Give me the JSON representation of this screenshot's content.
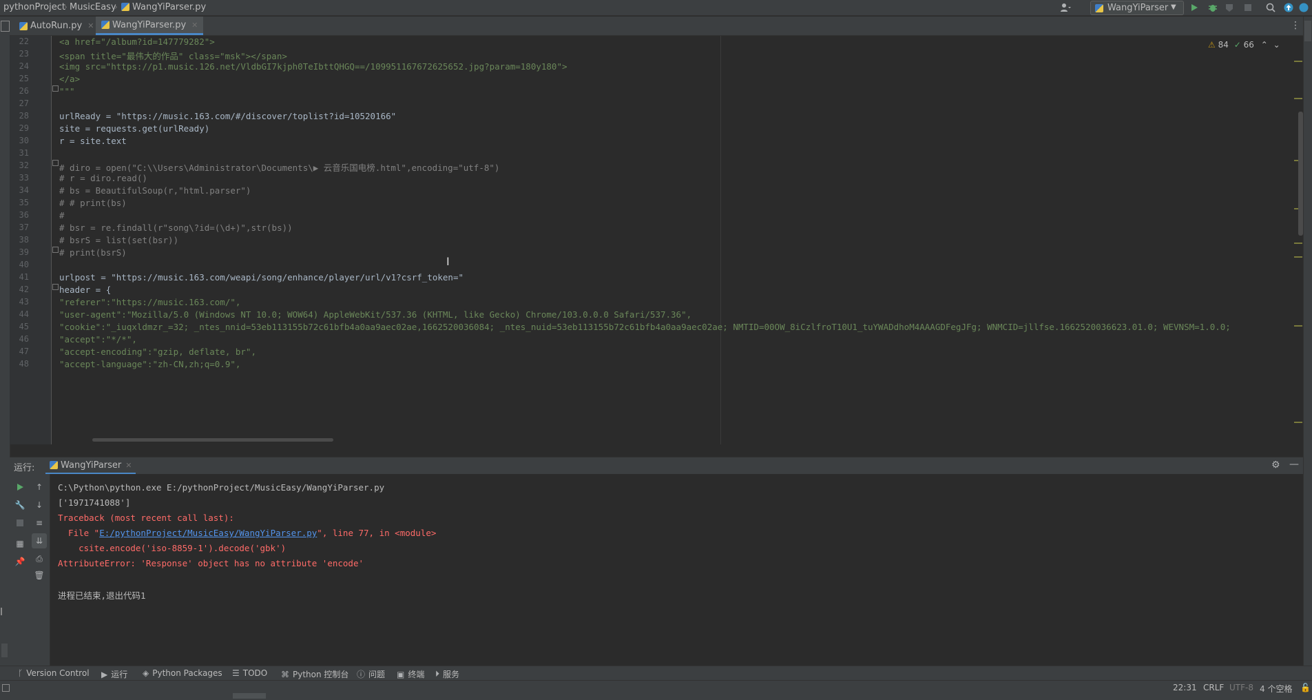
{
  "navbar": {
    "crumbs": [
      "pythonProject",
      "MusicEasy",
      "WangYiParser.py"
    ],
    "run_config": "WangYiParser"
  },
  "tabs": [
    {
      "label": "AutoRun.py",
      "active": false
    },
    {
      "label": "WangYiParser.py",
      "active": true
    }
  ],
  "editor": {
    "inspections": {
      "warnings": "84",
      "ok": "66"
    },
    "lines": [
      {
        "n": "22",
        "text": "<a href=\"/album?id=147779282\">"
      },
      {
        "n": "23",
        "text": "<span title=\"最伟大的作品\" class=\"msk\"></span>"
      },
      {
        "n": "24",
        "text": "<img src=\"https://p1.music.126.net/VldbGI7kjph0TeIbttQHGQ==/109951167672625652.jpg?param=180y180\">"
      },
      {
        "n": "25",
        "text": "</a>"
      },
      {
        "n": "26",
        "text": "\"\"\""
      },
      {
        "n": "27",
        "text": ""
      },
      {
        "n": "28",
        "text": "urlReady = \"https://music.163.com/#/discover/toplist?id=10520166\""
      },
      {
        "n": "29",
        "text": "site = requests.get(urlReady)"
      },
      {
        "n": "30",
        "text": "r = site.text"
      },
      {
        "n": "31",
        "text": ""
      },
      {
        "n": "32",
        "text": "# diro = open(\"C:\\\\Users\\Administrator\\Documents\\▶ 云音乐国电榜.html\",encoding=\"utf-8\")"
      },
      {
        "n": "33",
        "text": "# r = diro.read()"
      },
      {
        "n": "34",
        "text": "# bs = BeautifulSoup(r,\"html.parser\")"
      },
      {
        "n": "35",
        "text": "# # print(bs)"
      },
      {
        "n": "36",
        "text": "#"
      },
      {
        "n": "37",
        "text": "# bsr = re.findall(r\"song\\?id=(\\d+)\",str(bs))"
      },
      {
        "n": "38",
        "text": "# bsrS = list(set(bsr))"
      },
      {
        "n": "39",
        "text": "# print(bsrS)"
      },
      {
        "n": "40",
        "text": ""
      },
      {
        "n": "41",
        "text": "urlpost = \"https://music.163.com/weapi/song/enhance/player/url/v1?csrf_token=\""
      },
      {
        "n": "42",
        "text": "header = {"
      },
      {
        "n": "43",
        "text": "\"referer\":\"https://music.163.com/\","
      },
      {
        "n": "44",
        "text": "\"user-agent\":\"Mozilla/5.0 (Windows NT 10.0; WOW64) AppleWebKit/537.36 (KHTML, like Gecko) Chrome/103.0.0.0 Safari/537.36\","
      },
      {
        "n": "45",
        "text": "\"cookie\":\"_iuqxldmzr_=32; _ntes_nnid=53eb113155b72c61bfb4a0aa9aec02ae,1662520036084; _ntes_nuid=53eb113155b72c61bfb4a0aa9aec02ae; NMTID=00OW_8iCzlfroT10U1_tuYWADdhoM4AAAGDFegJFg; WNMCID=jllfse.1662520036623.01.0; WEVNSM=1.0.0;"
      },
      {
        "n": "46",
        "text": "\"accept\":\"*/*\","
      },
      {
        "n": "47",
        "text": "\"accept-encoding\":\"gzip, deflate, br\","
      },
      {
        "n": "48",
        "text": "\"accept-language\":\"zh-CN,zh;q=0.9\","
      }
    ]
  },
  "run": {
    "label": "运行:",
    "tab": "WangYiParser",
    "output": [
      {
        "text": "C:\\Python\\python.exe E:/pythonProject/MusicEasy/WangYiParser.py",
        "kind": "normal"
      },
      {
        "text": "['1971741088']",
        "kind": "normal"
      },
      {
        "text": "Traceback (most recent call last):",
        "kind": "error"
      },
      {
        "pre": "  File \"",
        "link": "E:/pythonProject/MusicEasy/WangYiParser.py",
        "post": "\", line 77, in <module>",
        "kind": "error-link"
      },
      {
        "text": "    csite.encode('iso-8859-1').decode('gbk')",
        "kind": "error"
      },
      {
        "text": "AttributeError: 'Response' object has no attribute 'encode'",
        "kind": "error"
      },
      {
        "text": "",
        "kind": "normal"
      },
      {
        "text": "进程已结束,退出代码1",
        "kind": "normal"
      }
    ]
  },
  "bottom_tools": [
    "Version Control",
    "运行",
    "Python Packages",
    "TODO",
    "Python 控制台",
    "问题",
    "终端",
    "服务"
  ],
  "status": {
    "position": "22:31",
    "line_sep": "CRLF",
    "encoding": "UTF-8",
    "indent": "4 个空格"
  },
  "colors": {
    "accent": "#4a88c7",
    "error": "#ff6b68",
    "string": "#6a8759",
    "comment": "#808080",
    "run_green": "#59a869"
  }
}
